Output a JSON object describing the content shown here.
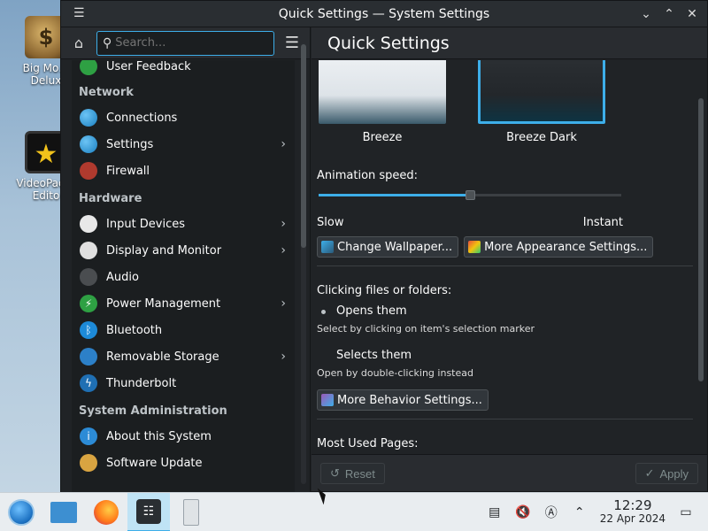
{
  "desktop": {
    "icons": [
      {
        "label": "Big Mo… Delux"
      },
      {
        "label": "VideoPad… Edito"
      }
    ]
  },
  "window": {
    "title": "Quick Settings — System Settings",
    "controls": [
      "chevron-down-icon",
      "chevron-up-icon",
      "close-icon"
    ]
  },
  "sidebar": {
    "search_placeholder": "Search...",
    "partial_item": "User Feedback",
    "sections": [
      {
        "title": "Network",
        "items": [
          {
            "label": "Connections",
            "icon": "globe-icon",
            "has_children": false
          },
          {
            "label": "Settings",
            "icon": "globe-icon",
            "has_children": true
          },
          {
            "label": "Firewall",
            "icon": "firewall-icon",
            "has_children": false
          }
        ]
      },
      {
        "title": "Hardware",
        "items": [
          {
            "label": "Input Devices",
            "icon": "mouse-icon",
            "has_children": true
          },
          {
            "label": "Display and Monitor",
            "icon": "display-icon",
            "has_children": true
          },
          {
            "label": "Audio",
            "icon": "audio-icon",
            "has_children": false
          },
          {
            "label": "Power Management",
            "icon": "power-icon",
            "has_children": true
          },
          {
            "label": "Bluetooth",
            "icon": "bluetooth-icon",
            "has_children": false
          },
          {
            "label": "Removable Storage",
            "icon": "usb-icon",
            "has_children": true
          },
          {
            "label": "Thunderbolt",
            "icon": "thunderbolt-icon",
            "has_children": false
          }
        ]
      },
      {
        "title": "System Administration",
        "items": [
          {
            "label": "About this System",
            "icon": "info-icon",
            "has_children": false
          },
          {
            "label": "Software Update",
            "icon": "update-icon",
            "has_children": false
          }
        ]
      }
    ]
  },
  "main": {
    "header": "Quick Settings",
    "themes": [
      {
        "label": "Breeze",
        "selected": false
      },
      {
        "label": "Breeze Dark",
        "selected": true
      }
    ],
    "animation_label": "Animation speed:",
    "animation_value": 0.5,
    "speed_min_label": "Slow",
    "speed_max_label": "Instant",
    "change_wallpaper": "Change Wallpaper...",
    "more_appearance": "More Appearance Settings...",
    "clicking_label": "Clicking files or folders:",
    "opens_them": "Opens them",
    "opens_hint": "Select by clicking on item's selection marker",
    "selects_them": "Selects them",
    "selects_hint": "Open by double-clicking instead",
    "more_behavior": "More Behavior Settings...",
    "most_used": "Most Used Pages:",
    "reset": "Reset",
    "apply": "Apply"
  },
  "taskbar": {
    "time": "12:29",
    "date": "22 Apr 2024"
  },
  "colors": {
    "accent": "#3daee9",
    "window_bg": "#202326",
    "taskbar_bg": "#e9edf0"
  }
}
